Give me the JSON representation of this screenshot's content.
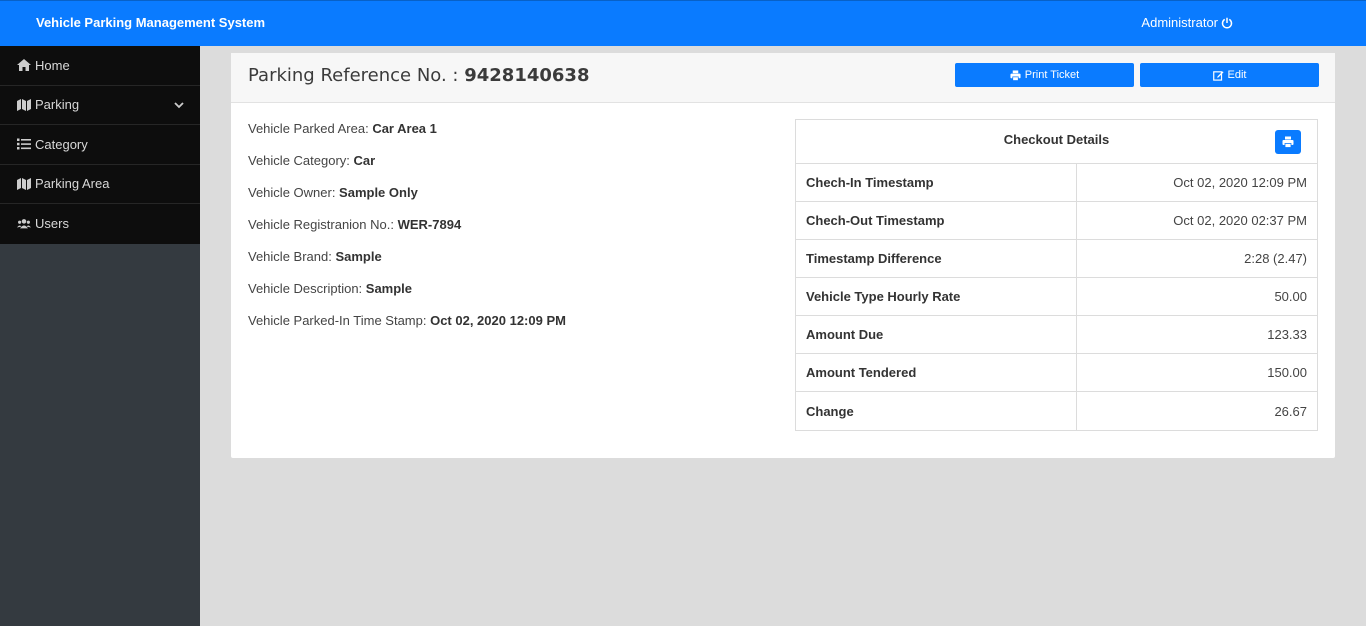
{
  "header": {
    "brand": "Vehicle Parking Management System",
    "user": "Administrator",
    "power_icon": "power-icon"
  },
  "sidebar": {
    "items": [
      {
        "label": "Home",
        "icon": "home-icon"
      },
      {
        "label": "Parking",
        "icon": "map-icon"
      },
      {
        "label": "Category",
        "icon": "list-icon"
      },
      {
        "label": "Parking Area",
        "icon": "map-icon"
      },
      {
        "label": "Users",
        "icon": "users-icon"
      }
    ]
  },
  "card": {
    "title_prefix": "Parking Reference No. : ",
    "reference_no": "9428140638",
    "print_label": "Print Ticket",
    "edit_label": "Edit"
  },
  "details": [
    {
      "label": "Vehicle Parked Area: ",
      "value": "Car Area 1"
    },
    {
      "label": "Vehicle Category: ",
      "value": "Car"
    },
    {
      "label": "Vehicle Owner: ",
      "value": "Sample Only"
    },
    {
      "label": "Vehicle Registranion No.: ",
      "value": "WER-7894"
    },
    {
      "label": "Vehicle Brand: ",
      "value": "Sample"
    },
    {
      "label": "Vehicle Description: ",
      "value": "Sample"
    },
    {
      "label": "Vehicle Parked-In Time Stamp: ",
      "value": "Oct 02, 2020 12:09 PM"
    }
  ],
  "checkout": {
    "title": "Checkout Details",
    "rows": [
      {
        "label": "Chech-In Timestamp",
        "value": "Oct 02, 2020 12:09 PM"
      },
      {
        "label": "Chech-Out Timestamp",
        "value": "Oct 02, 2020 02:37 PM"
      },
      {
        "label": "Timestamp Difference",
        "value": "2:28 (2.47)"
      },
      {
        "label": "Vehicle Type Hourly Rate",
        "value": "50.00"
      },
      {
        "label": "Amount Due",
        "value": "123.33"
      },
      {
        "label": "Amount Tendered",
        "value": "150.00"
      },
      {
        "label": "Change",
        "value": "26.67"
      }
    ]
  },
  "colors": {
    "primary": "#0a7bff",
    "sidebar": "#0d0d0d",
    "sidebar_rest": "#343a40",
    "background": "#dcdcdc"
  }
}
